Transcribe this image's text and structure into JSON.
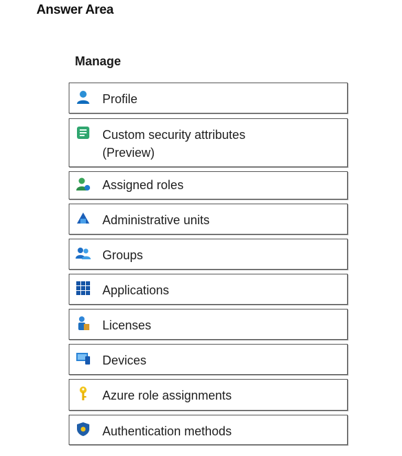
{
  "header": {
    "title": "Answer Area"
  },
  "manage": {
    "heading": "Manage",
    "items": [
      {
        "label": "Profile",
        "icon": "profile-icon"
      },
      {
        "label": "Custom security attributes\n(Preview)",
        "icon": "security-attributes-icon"
      },
      {
        "label": "Assigned roles",
        "icon": "assigned-roles-icon"
      },
      {
        "label": "Administrative units",
        "icon": "administrative-units-icon"
      },
      {
        "label": "Groups",
        "icon": "groups-icon"
      },
      {
        "label": "Applications",
        "icon": "applications-icon"
      },
      {
        "label": "Licenses",
        "icon": "licenses-icon"
      },
      {
        "label": "Devices",
        "icon": "devices-icon"
      },
      {
        "label": "Azure role assignments",
        "icon": "key-icon"
      },
      {
        "label": "Authentication methods",
        "icon": "shield-icon"
      }
    ]
  }
}
